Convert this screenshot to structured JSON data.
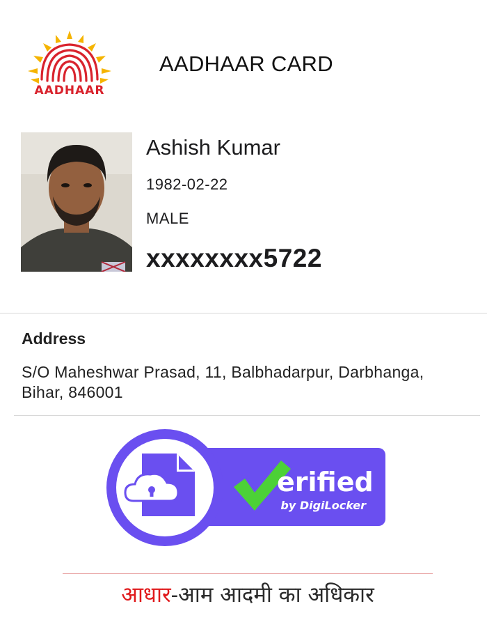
{
  "header": {
    "logo_text": "AADHAAR",
    "title": "AADHAAR CARD"
  },
  "profile": {
    "name": "Ashish Kumar",
    "dob": "1982-02-22",
    "gender": "MALE",
    "uid_masked": "xxxxxxxx5722"
  },
  "address": {
    "label": "Address",
    "value": "S/O Maheshwar Prasad, 11, Balbhadarpur, Darbhanga, Bihar, 846001"
  },
  "badge": {
    "check_letter": "V",
    "word_rest": "erified",
    "by_text": "by DigiLocker",
    "colors": {
      "purple": "#6a4ff0",
      "green": "#4cd137",
      "white": "#ffffff"
    }
  },
  "motto": {
    "highlight": "आधार",
    "rest": "-आम आदमी का अधिकार"
  }
}
